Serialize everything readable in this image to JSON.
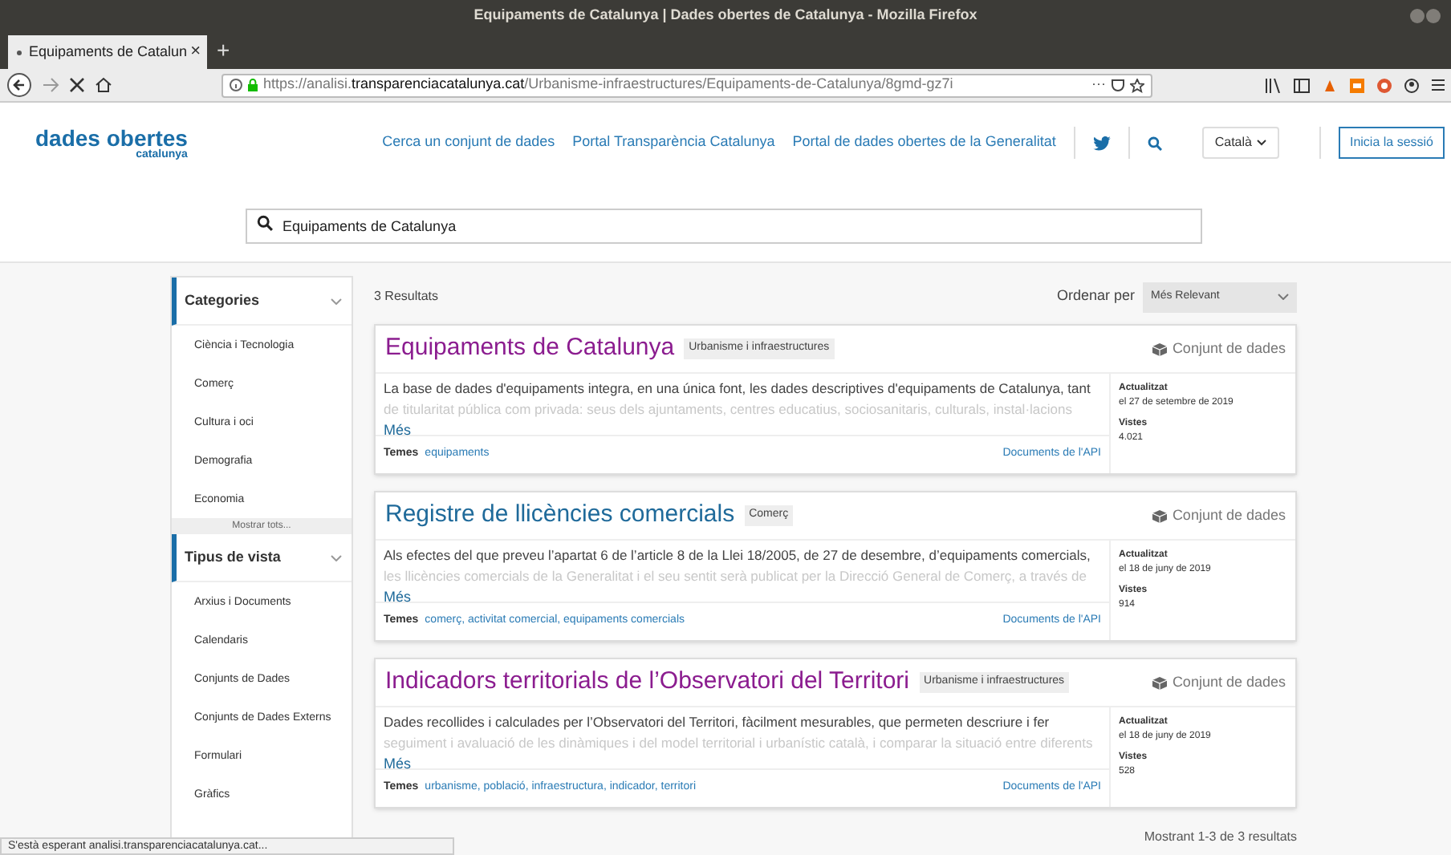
{
  "window": {
    "title": "Equipaments de Catalunya | Dades obertes de Catalunya - Mozilla Firefox"
  },
  "browser_tab": {
    "label": "Equipaments de Catalun",
    "close": "×",
    "new_tab": "+"
  },
  "address_bar": {
    "url_prefix": "https://analisi.",
    "url_domain": "transparenciacatalunya.cat",
    "url_path": "/Urbanisme-infraestructures/Equipaments-de-Catalunya/8gmd-gz7i",
    "more": "···"
  },
  "header": {
    "logo_main": "dades obertes",
    "logo_sub": "catalunya",
    "links": [
      "Cerca un conjunt de dades",
      "Portal Transparència Catalunya",
      "Portal de dades obertes de la Generalitat"
    ],
    "language": "Català",
    "sign_in": "Inicia la sessió"
  },
  "search": {
    "value": "Equipaments de Catalunya"
  },
  "sidebar": {
    "sections": [
      {
        "title": "Categories",
        "items": [
          "Ciència i Tecnologia",
          "Comerç",
          "Cultura i oci",
          "Demografia",
          "Economia"
        ],
        "show_all": "Mostrar tots..."
      },
      {
        "title": "Tipus de vista",
        "items": [
          "Arxius i Documents",
          "Calendaris",
          "Conjunts de Dades",
          "Conjunts de Dades Externs",
          "Formulari",
          "Gràfics"
        ]
      }
    ]
  },
  "results": {
    "count": "3 Resultats",
    "sort_label": "Ordenar per",
    "sort_value": "Més Relevant",
    "footer": "Mostrant 1-3 de 3 resultats",
    "items": [
      {
        "title": "Equipaments de Catalunya",
        "visited": true,
        "category": "Urbanisme i infraestructures",
        "type": "Conjunt de dades",
        "description": [
          "La base de dades d'equipaments integra, en una única font, les dades descriptives d'equipaments de Catalunya, tant",
          "de titularitat pública com privada: seus dels ajuntaments, centres educatius, sociosanitaris, culturals, instal·lacions"
        ],
        "more": "Més",
        "topics_label": "Temes",
        "topics": "equipaments",
        "api": "Documents de l'API",
        "updated_label": "Actualitzat",
        "updated": "el 27 de setembre de 2019",
        "views_label": "Vistes",
        "views": "4.021"
      },
      {
        "title": "Registre de llicències comercials",
        "visited": false,
        "category": "Comerç",
        "type": "Conjunt de dades",
        "description": [
          "Als efectes del que preveu l’apartat 6 de l’article 8 de la Llei 18/2005, de 27 de desembre, d’equipaments comercials,",
          "les llicències comercials de la Generalitat i el seu sentit serà publicat per la Direcció General de Comerç, a través de"
        ],
        "more": "Més",
        "topics_label": "Temes",
        "topics": "comerç, activitat comercial, equipaments comercials",
        "api": "Documents de l'API",
        "updated_label": "Actualitzat",
        "updated": "el 18 de juny de 2019",
        "views_label": "Vistes",
        "views": "914"
      },
      {
        "title": "Indicadors territorials de l’Observatori del Territori",
        "visited": true,
        "category": "Urbanisme i infraestructures",
        "type": "Conjunt de dades",
        "description": [
          "Dades recollides i calculades per l’Observatori del Territori, fàcilment mesurables, que permeten descriure i fer",
          "seguiment i avaluació de les dinàmiques i del model territorial i urbanístic català, i comparar la situació entre diferents"
        ],
        "more": "Més",
        "topics_label": "Temes",
        "topics": "urbanisme, població, infraestructura, indicador, territori",
        "api": "Documents de l'API",
        "updated_label": "Actualitzat",
        "updated": "el 18 de juny de 2019",
        "views_label": "Vistes",
        "views": "528"
      }
    ]
  },
  "status_bar": {
    "text": "S'està esperant analisi.transparenciacatalunya.cat..."
  }
}
